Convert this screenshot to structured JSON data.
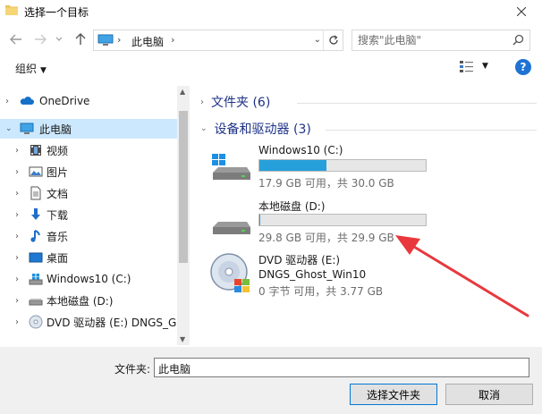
{
  "window": {
    "title": "选择一个目标"
  },
  "nav": {
    "breadcrumb": "此电脑",
    "search_placeholder": "搜索\"此电脑\""
  },
  "toolbar": {
    "organize": "组织",
    "help": "?"
  },
  "sidebar": {
    "items": [
      {
        "label": "OneDrive",
        "icon": "cloud-icon"
      },
      {
        "label": "此电脑",
        "icon": "computer-icon"
      },
      {
        "label": "视频",
        "icon": "video-icon"
      },
      {
        "label": "图片",
        "icon": "picture-icon"
      },
      {
        "label": "文档",
        "icon": "document-icon"
      },
      {
        "label": "下载",
        "icon": "download-icon"
      },
      {
        "label": "音乐",
        "icon": "music-icon"
      },
      {
        "label": "桌面",
        "icon": "desktop-icon"
      },
      {
        "label": "Windows10 (C:)",
        "icon": "windows-drive-icon"
      },
      {
        "label": "本地磁盘 (D:)",
        "icon": "hard-drive-icon"
      },
      {
        "label": "DVD 驱动器 (E:) DNGS_Gh",
        "icon": "dvd-icon"
      }
    ]
  },
  "main": {
    "folders_header": "文件夹 (6)",
    "devices_header": "设备和驱动器 (3)",
    "drives": [
      {
        "name": "Windows10 (C:)",
        "info": "17.9 GB 可用，共 30.0 GB",
        "used_fraction": 0.403
      },
      {
        "name": "本地磁盘 (D:)",
        "info": "29.8 GB 可用，共 29.9 GB",
        "used_fraction": 0.003
      },
      {
        "name": "DVD 驱动器 (E:)",
        "label": "DNGS_Ghost_Win10",
        "info": "0 字节 可用，共 3.77 GB"
      }
    ]
  },
  "footer": {
    "folder_label": "文件夹:",
    "folder_value": "此电脑",
    "select_button": "选择文件夹",
    "cancel_button": "取消"
  },
  "colors": {
    "accent": "#26a0da",
    "selected": "#cce8ff",
    "annotation": "#e8383d"
  }
}
